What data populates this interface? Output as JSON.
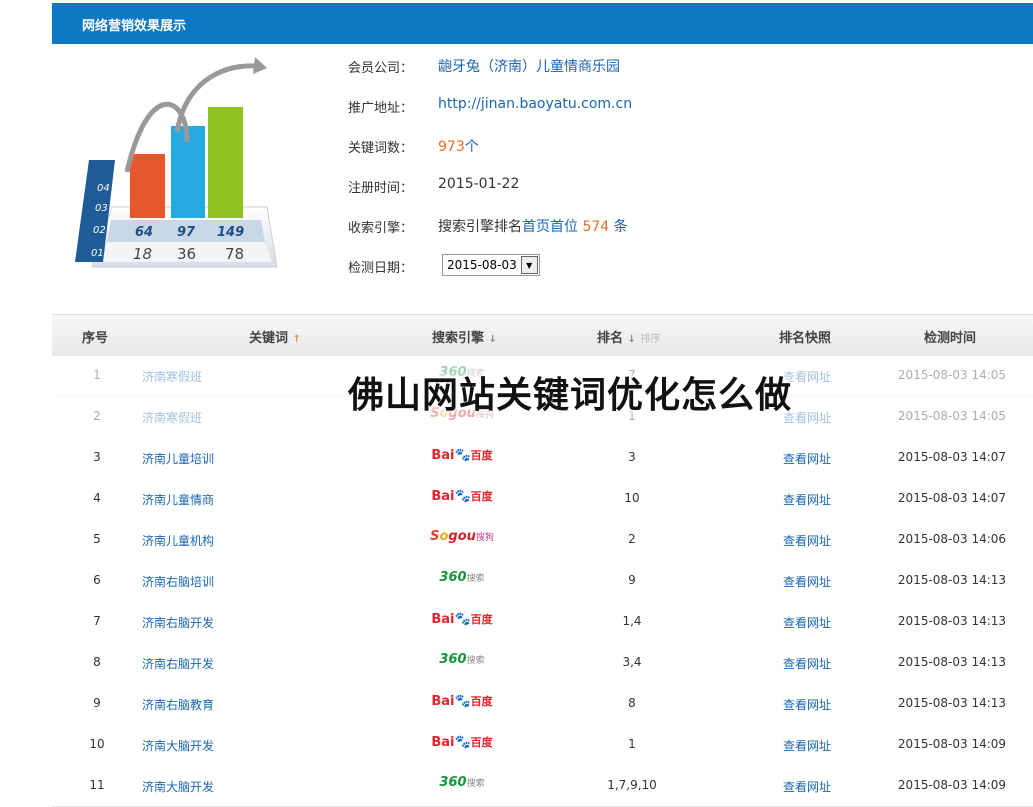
{
  "header": {
    "title": "网络营销效果展示"
  },
  "chart_graphic": {
    "row_labels": [
      "04",
      "03",
      "02",
      "01"
    ],
    "top_values": [
      "64",
      "97",
      "149"
    ],
    "bottom_values": [
      "18",
      "36",
      "78"
    ],
    "bar_colors": [
      "#e8572b",
      "#27a9e1",
      "#8dc21f"
    ]
  },
  "info": {
    "company_label": "会员公司：",
    "company_value": "龅牙兔（济南）儿童情商乐园",
    "url_label": "推广地址：",
    "url_value": "http://jinan.baoyatu.com.cn",
    "keywords_label": "关键词数：",
    "keywords_count": "973",
    "keywords_unit": "个",
    "reg_label": "注册时间：",
    "reg_value": "2015-01-22",
    "index_label": "收索引擎：",
    "index_prefix": "搜索引擎排名",
    "index_link": "首页首位",
    "index_count": "574",
    "index_unit": "条",
    "check_label": "检测日期：",
    "check_date": "2015-08-03"
  },
  "table": {
    "headers": {
      "index": "序号",
      "keyword": "关键词",
      "engine": "搜索引擎",
      "rank": "排名",
      "rank_ghost": "排序",
      "snapshot": "排名快照",
      "time": "检测时间"
    },
    "rows": [
      {
        "idx": "1",
        "kw": "济南寒假班",
        "engine": "360",
        "rank": "7",
        "link": "查看网址",
        "time": "2015-08-03 14:05"
      },
      {
        "idx": "2",
        "kw": "济南寒假班",
        "engine": "sogou",
        "rank": "1",
        "link": "查看网址",
        "time": "2015-08-03 14:05"
      },
      {
        "idx": "3",
        "kw": "济南儿童培训",
        "engine": "baidu",
        "rank": "3",
        "link": "查看网址",
        "time": "2015-08-03 14:07"
      },
      {
        "idx": "4",
        "kw": "济南儿童情商",
        "engine": "baidu",
        "rank": "10",
        "link": "查看网址",
        "time": "2015-08-03 14:07"
      },
      {
        "idx": "5",
        "kw": "济南儿童机构",
        "engine": "sogou",
        "rank": "2",
        "link": "查看网址",
        "time": "2015-08-03 14:06"
      },
      {
        "idx": "6",
        "kw": "济南右脑培训",
        "engine": "360",
        "rank": "9",
        "link": "查看网址",
        "time": "2015-08-03 14:13"
      },
      {
        "idx": "7",
        "kw": "济南右脑开发",
        "engine": "baidu",
        "rank": "1,4",
        "link": "查看网址",
        "time": "2015-08-03 14:13"
      },
      {
        "idx": "8",
        "kw": "济南右脑开发",
        "engine": "360",
        "rank": "3,4",
        "link": "查看网址",
        "time": "2015-08-03 14:13"
      },
      {
        "idx": "9",
        "kw": "济南右脑教育",
        "engine": "baidu",
        "rank": "8",
        "link": "查看网址",
        "time": "2015-08-03 14:13"
      },
      {
        "idx": "10",
        "kw": "济南大脑开发",
        "engine": "baidu",
        "rank": "1",
        "link": "查看网址",
        "time": "2015-08-03 14:09"
      },
      {
        "idx": "11",
        "kw": "济南大脑开发",
        "engine": "360",
        "rank": "1,7,9,10",
        "link": "查看网址",
        "time": "2015-08-03 14:09"
      }
    ]
  },
  "engine_logos": {
    "baidu": {
      "a": "Bai",
      "paw": "🐾",
      "b": "百度"
    },
    "sogou": {
      "s": "S",
      "o": "o",
      "g": "gou",
      "t": "搜狗"
    },
    "360": {
      "main": "360",
      "t": "搜索"
    }
  },
  "overlay": {
    "title": "佛山网站关键词优化怎么做"
  }
}
